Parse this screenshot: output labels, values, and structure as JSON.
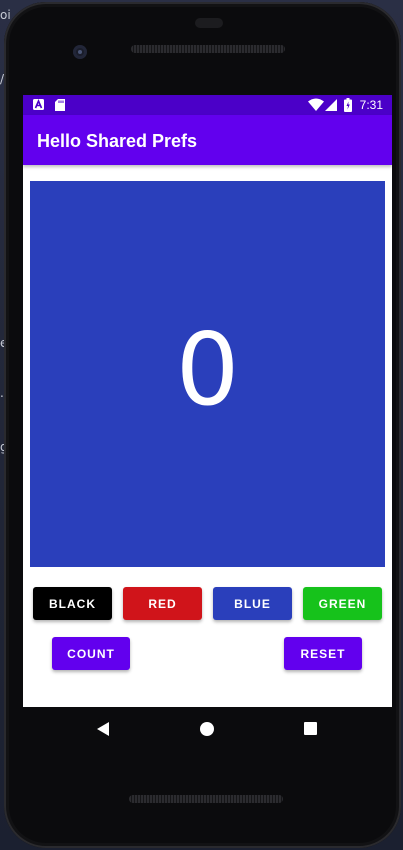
{
  "status_bar": {
    "time": "7:31",
    "left_icons": [
      "notification-a-icon",
      "sd-card-icon"
    ],
    "right_icons": [
      "wifi-icon",
      "cell-signal-icon",
      "battery-icon"
    ]
  },
  "app_bar": {
    "title": "Hello Shared Prefs"
  },
  "count_display": {
    "value": "0",
    "background": "#2a3fbb"
  },
  "color_buttons": [
    {
      "label": "BLACK",
      "color": "#000000"
    },
    {
      "label": "RED",
      "color": "#d0141a"
    },
    {
      "label": "BLUE",
      "color": "#2a3fbb"
    },
    {
      "label": "GREEN",
      "color": "#16c21b"
    }
  ],
  "actions": {
    "count_label": "COUNT",
    "reset_label": "RESET",
    "accent": "#6200ee"
  },
  "navigation": [
    "back-icon",
    "home-icon",
    "recents-icon"
  ],
  "desktop_edge_text": [
    "oi",
    "/",
    "e",
    ".",
    "g"
  ]
}
